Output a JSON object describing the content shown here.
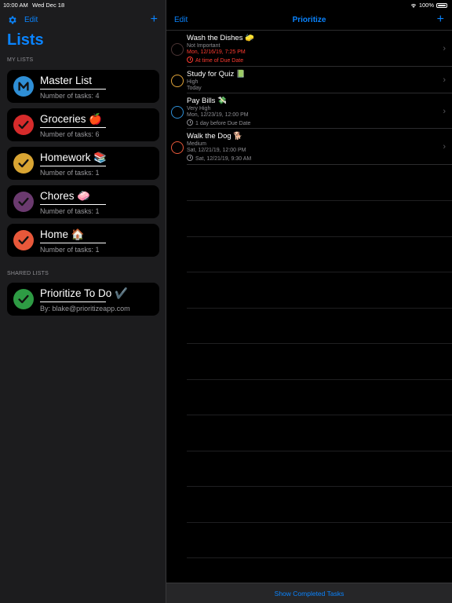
{
  "status_bar": {
    "time": "10:00 AM",
    "date": "Wed Dec 18",
    "battery": "100%"
  },
  "sidebar": {
    "edit_label": "Edit",
    "add_label": "+",
    "title": "Lists",
    "my_lists_header": "MY LISTS",
    "shared_lists_header": "SHARED LISTS",
    "my_lists": [
      {
        "name": "Master List",
        "subtitle": "Number of tasks: 4",
        "color": "#2f8fd6",
        "icon": "m-logo-icon"
      },
      {
        "name": "Groceries 🍎",
        "subtitle": "Number of tasks: 6",
        "color": "#d62b2b",
        "icon": "check-icon"
      },
      {
        "name": "Homework 📚",
        "subtitle": "Number of tasks: 1",
        "color": "#d9a533",
        "icon": "check-icon"
      },
      {
        "name": "Chores 🧼",
        "subtitle": "Number of tasks: 1",
        "color": "#6b3a6f",
        "icon": "check-icon"
      },
      {
        "name": "Home 🏠",
        "subtitle": "Number of tasks: 1",
        "color": "#e8583a",
        "icon": "check-icon"
      }
    ],
    "shared_lists": [
      {
        "name": "Prioritize To Do ✔️",
        "subtitle": "By: blake@prioritizeapp.com",
        "color": "#2e9b44",
        "icon": "check-icon"
      }
    ]
  },
  "main": {
    "edit_label": "Edit",
    "title": "Prioritize",
    "add_label": "+",
    "tasks": [
      {
        "title": "Wash the Dishes 🧽",
        "priority": "Not Important",
        "due": "Mon, 12/16/19, 7:25 PM",
        "reminder": "At time of Due Date",
        "circle_color": "#4a3434",
        "overdue": true
      },
      {
        "title": "Study for Quiz 📗",
        "priority": "High",
        "due": "Today",
        "reminder": "",
        "circle_color": "#e2a53a",
        "overdue": false
      },
      {
        "title": "Pay Bills 💸",
        "priority": "Very High",
        "due": "Mon, 12/23/19, 12:00 PM",
        "reminder": "1 day before Due Date",
        "circle_color": "#2f8fd6",
        "overdue": false
      },
      {
        "title": "Walk the Dog 🐕",
        "priority": "Medium",
        "due": "Sat, 12/21/19, 12:00 PM",
        "reminder": "Sat, 12/21/19, 9:30 AM",
        "circle_color": "#e8583a",
        "overdue": false
      }
    ],
    "show_completed_label": "Show Completed Tasks"
  },
  "colors": {
    "accent": "#0a84ff",
    "overdue": "#ff3b30"
  }
}
